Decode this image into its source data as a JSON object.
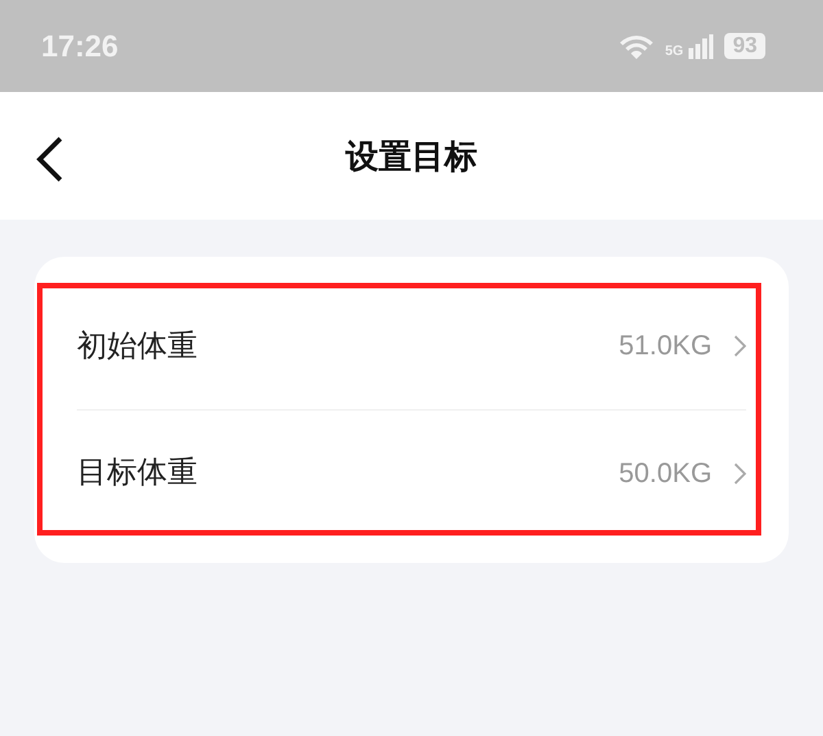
{
  "status_bar": {
    "time": "17:26",
    "network": "5G",
    "battery": "93"
  },
  "header": {
    "title": "设置目标"
  },
  "settings": [
    {
      "label": "初始体重",
      "value": "51.0KG"
    },
    {
      "label": "目标体重",
      "value": "50.0KG"
    }
  ],
  "annotation": {
    "kind": "highlight"
  }
}
